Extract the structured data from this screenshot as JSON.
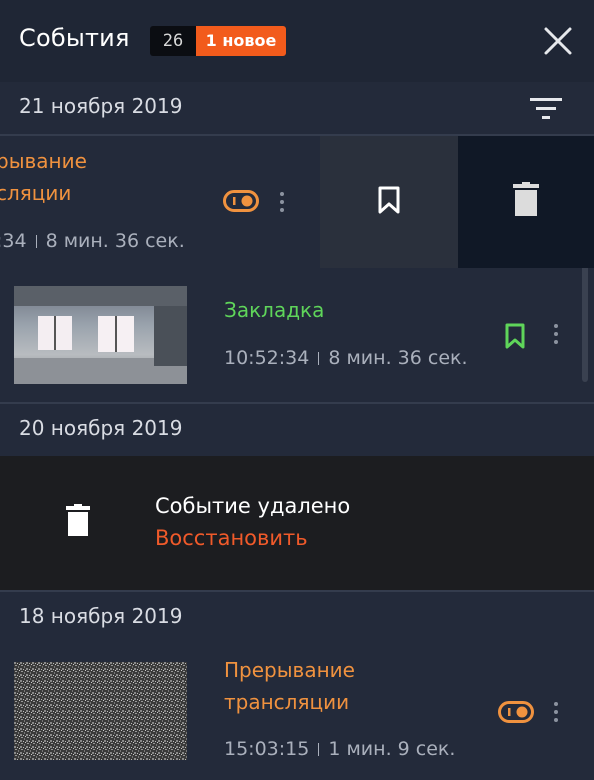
{
  "header": {
    "title": "События",
    "count": "26",
    "new_badge": "1 новое"
  },
  "groups": [
    {
      "date": "21 ноября 2019",
      "events": [
        {
          "title_line1": "рывание",
          "title_line2": "сляции",
          "time": ":34",
          "duration": "8 мин. 36 сек.",
          "type": "stream-interruption",
          "swiped": true
        },
        {
          "title": "Закладка",
          "time": "10:52:34",
          "duration": "8 мин. 36 сек.",
          "type": "bookmark"
        }
      ]
    },
    {
      "date": "20 ноября 2019",
      "deleted": {
        "text": "Событие удалено",
        "action": "Восстановить"
      }
    },
    {
      "date": "18 ноября 2019",
      "events": [
        {
          "title_line1": "Прерывание",
          "title_line2": "трансляции",
          "time": "15:03:15",
          "duration": "1 мин. 9 сек.",
          "type": "stream-interruption"
        }
      ]
    }
  ],
  "colors": {
    "accent": "#f25b1c",
    "interruption": "#f0923f",
    "bookmark": "#5fd55a",
    "restore": "#f05a2a",
    "background": "#232a3a"
  },
  "icons": [
    "close-icon",
    "filter-icon",
    "toggle-icon",
    "more-vertical-icon",
    "bookmark-icon",
    "trash-icon"
  ]
}
